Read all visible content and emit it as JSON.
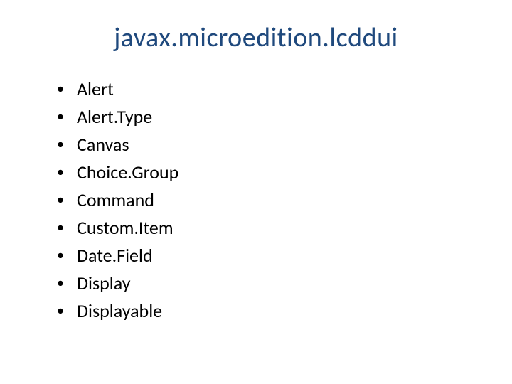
{
  "title": "javax.microedition.lcddui",
  "items": [
    "Alert",
    "Alert.Type",
    "Canvas",
    "Choice.Group",
    "Command",
    "Custom.Item",
    "Date.Field",
    "Display",
    "Displayable"
  ]
}
